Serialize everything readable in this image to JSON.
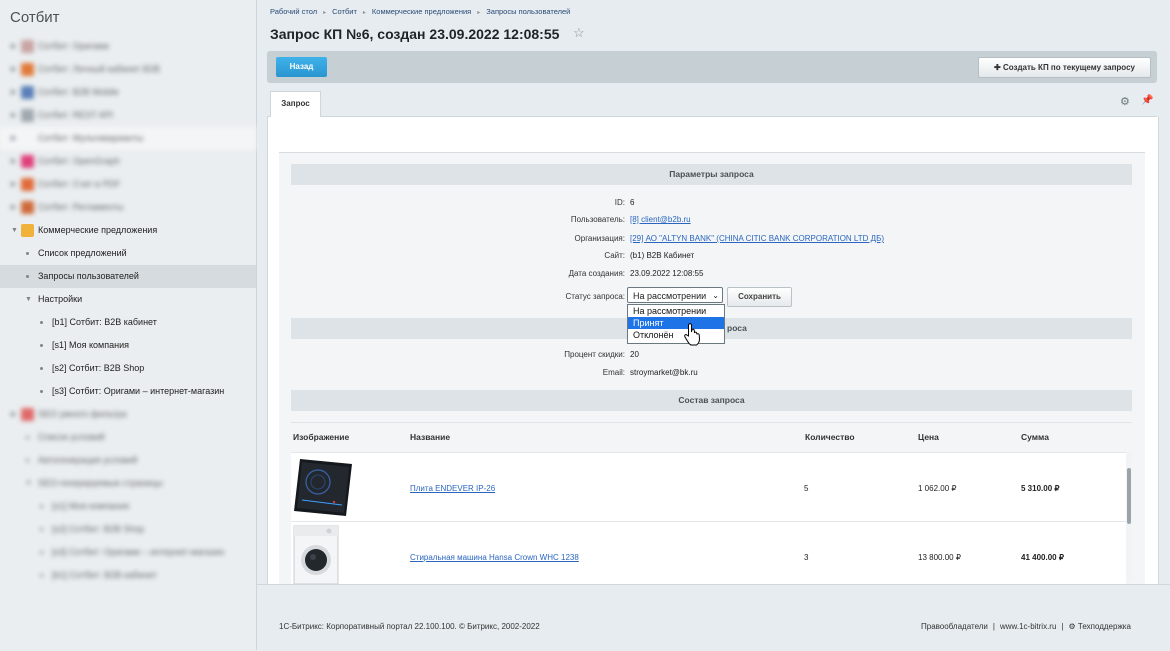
{
  "sidebar": {
    "title": "Сотбит",
    "items": [
      {
        "label": "Сотбит: Оригами",
        "blurred": true
      },
      {
        "label": "Сотбит: Личный кабинет B2B",
        "blurred": true
      },
      {
        "label": "Сотбит: B2B Mobile",
        "blurred": true
      },
      {
        "label": "Сотбит: REST API",
        "blurred": true
      },
      {
        "label": "Сотбит: Мультиварианты",
        "blurred": true
      },
      {
        "label": "Сотбит: OpenGraph",
        "blurred": true
      },
      {
        "label": "Сотбит: Счет в PDF",
        "blurred": true
      },
      {
        "label": "Сотбит: Регламенты",
        "blurred": true
      },
      {
        "label": "Коммерческие предложения",
        "blurred": false
      },
      {
        "label": "Список предложений",
        "blurred": false
      },
      {
        "label": "Запросы пользователей",
        "blurred": false
      },
      {
        "label": "Настройки",
        "blurred": false
      },
      {
        "label": "[b1] Сотбит: B2B кабинет",
        "blurred": false
      },
      {
        "label": "[s1] Моя компания",
        "blurred": false
      },
      {
        "label": "[s2] Сотбит: B2B Shop",
        "blurred": false
      },
      {
        "label": "[s3] Сотбит: Оригами – интернет-магазин",
        "blurred": false
      },
      {
        "label": "SEO умного фильтра",
        "blurred": true
      },
      {
        "label": "Список условий",
        "blurred": true
      },
      {
        "label": "Автогенерация условий",
        "blurred": true
      },
      {
        "label": "SEO-генерируемые страницы",
        "blurred": true
      },
      {
        "label": "[s1] Моя компания",
        "blurred": true
      },
      {
        "label": "[s2] Сотбит: B2B Shop",
        "blurred": true
      },
      {
        "label": "[s3] Сотбит: Оригами – интернет-магазин",
        "blurred": true
      },
      {
        "label": "[b1] Сотбит: B2B кабинет",
        "blurred": true
      }
    ]
  },
  "breadcrumb": [
    "Рабочий стол",
    "Сотбит",
    "Коммерческие предложения",
    "Запросы пользователей"
  ],
  "page": {
    "title": "Запрос КП №6, создан 23.09.2022 12:08:55",
    "back_label": "Назад",
    "create_label": "Создать КП по текущему запросу",
    "tab_label": "Запрос"
  },
  "params": {
    "section_title": "Параметры запроса",
    "id_label": "ID:",
    "id_value": "6",
    "user_label": "Пользователь:",
    "user_value": "[8] client@b2b.ru",
    "org_label": "Организация:",
    "org_value": "[29] АО \"ALTYN BANK\" (CHINA CITIC BANK CORPORATION LTD ДБ)",
    "site_label": "Сайт:",
    "site_value": "(b1) B2B Кабинет",
    "date_label": "Дата создания:",
    "date_value": "23.09.2022 12:08:55",
    "status_label": "Статус запроса:",
    "status_value": "На рассмотрении",
    "save_label": "Сохранить",
    "status_options": [
      "На рассмотрении",
      "Принят",
      "Отклонён"
    ],
    "status_highlighted": "Принят"
  },
  "extra": {
    "section_title_visible": "роса",
    "discount_label": "Процент скидки:",
    "discount_value": "20",
    "email_label": "Email:",
    "email_value": "stroymarket@bk.ru"
  },
  "composition": {
    "section_title": "Состав запроса",
    "columns": [
      "Изображение",
      "Название",
      "Количество",
      "Цена",
      "Сумма"
    ],
    "rows": [
      {
        "name": "Плита ENDEVER IP-26",
        "qty": "5",
        "price": "1 062.00 ₽",
        "sum": "5 310.00 ₽"
      },
      {
        "name": "Стиральная машина Hansa Crown WHC 1238",
        "qty": "3",
        "price": "13 800.00 ₽",
        "sum": "41 400.00 ₽"
      }
    ]
  },
  "footer": {
    "left": "1С-Битрикс: Корпоративный портал 22.100.100. © Битрикс, 2002-2022",
    "rights": "Правообладатели",
    "site": "www.1c-bitrix.ru",
    "support": "Техподдержка"
  }
}
